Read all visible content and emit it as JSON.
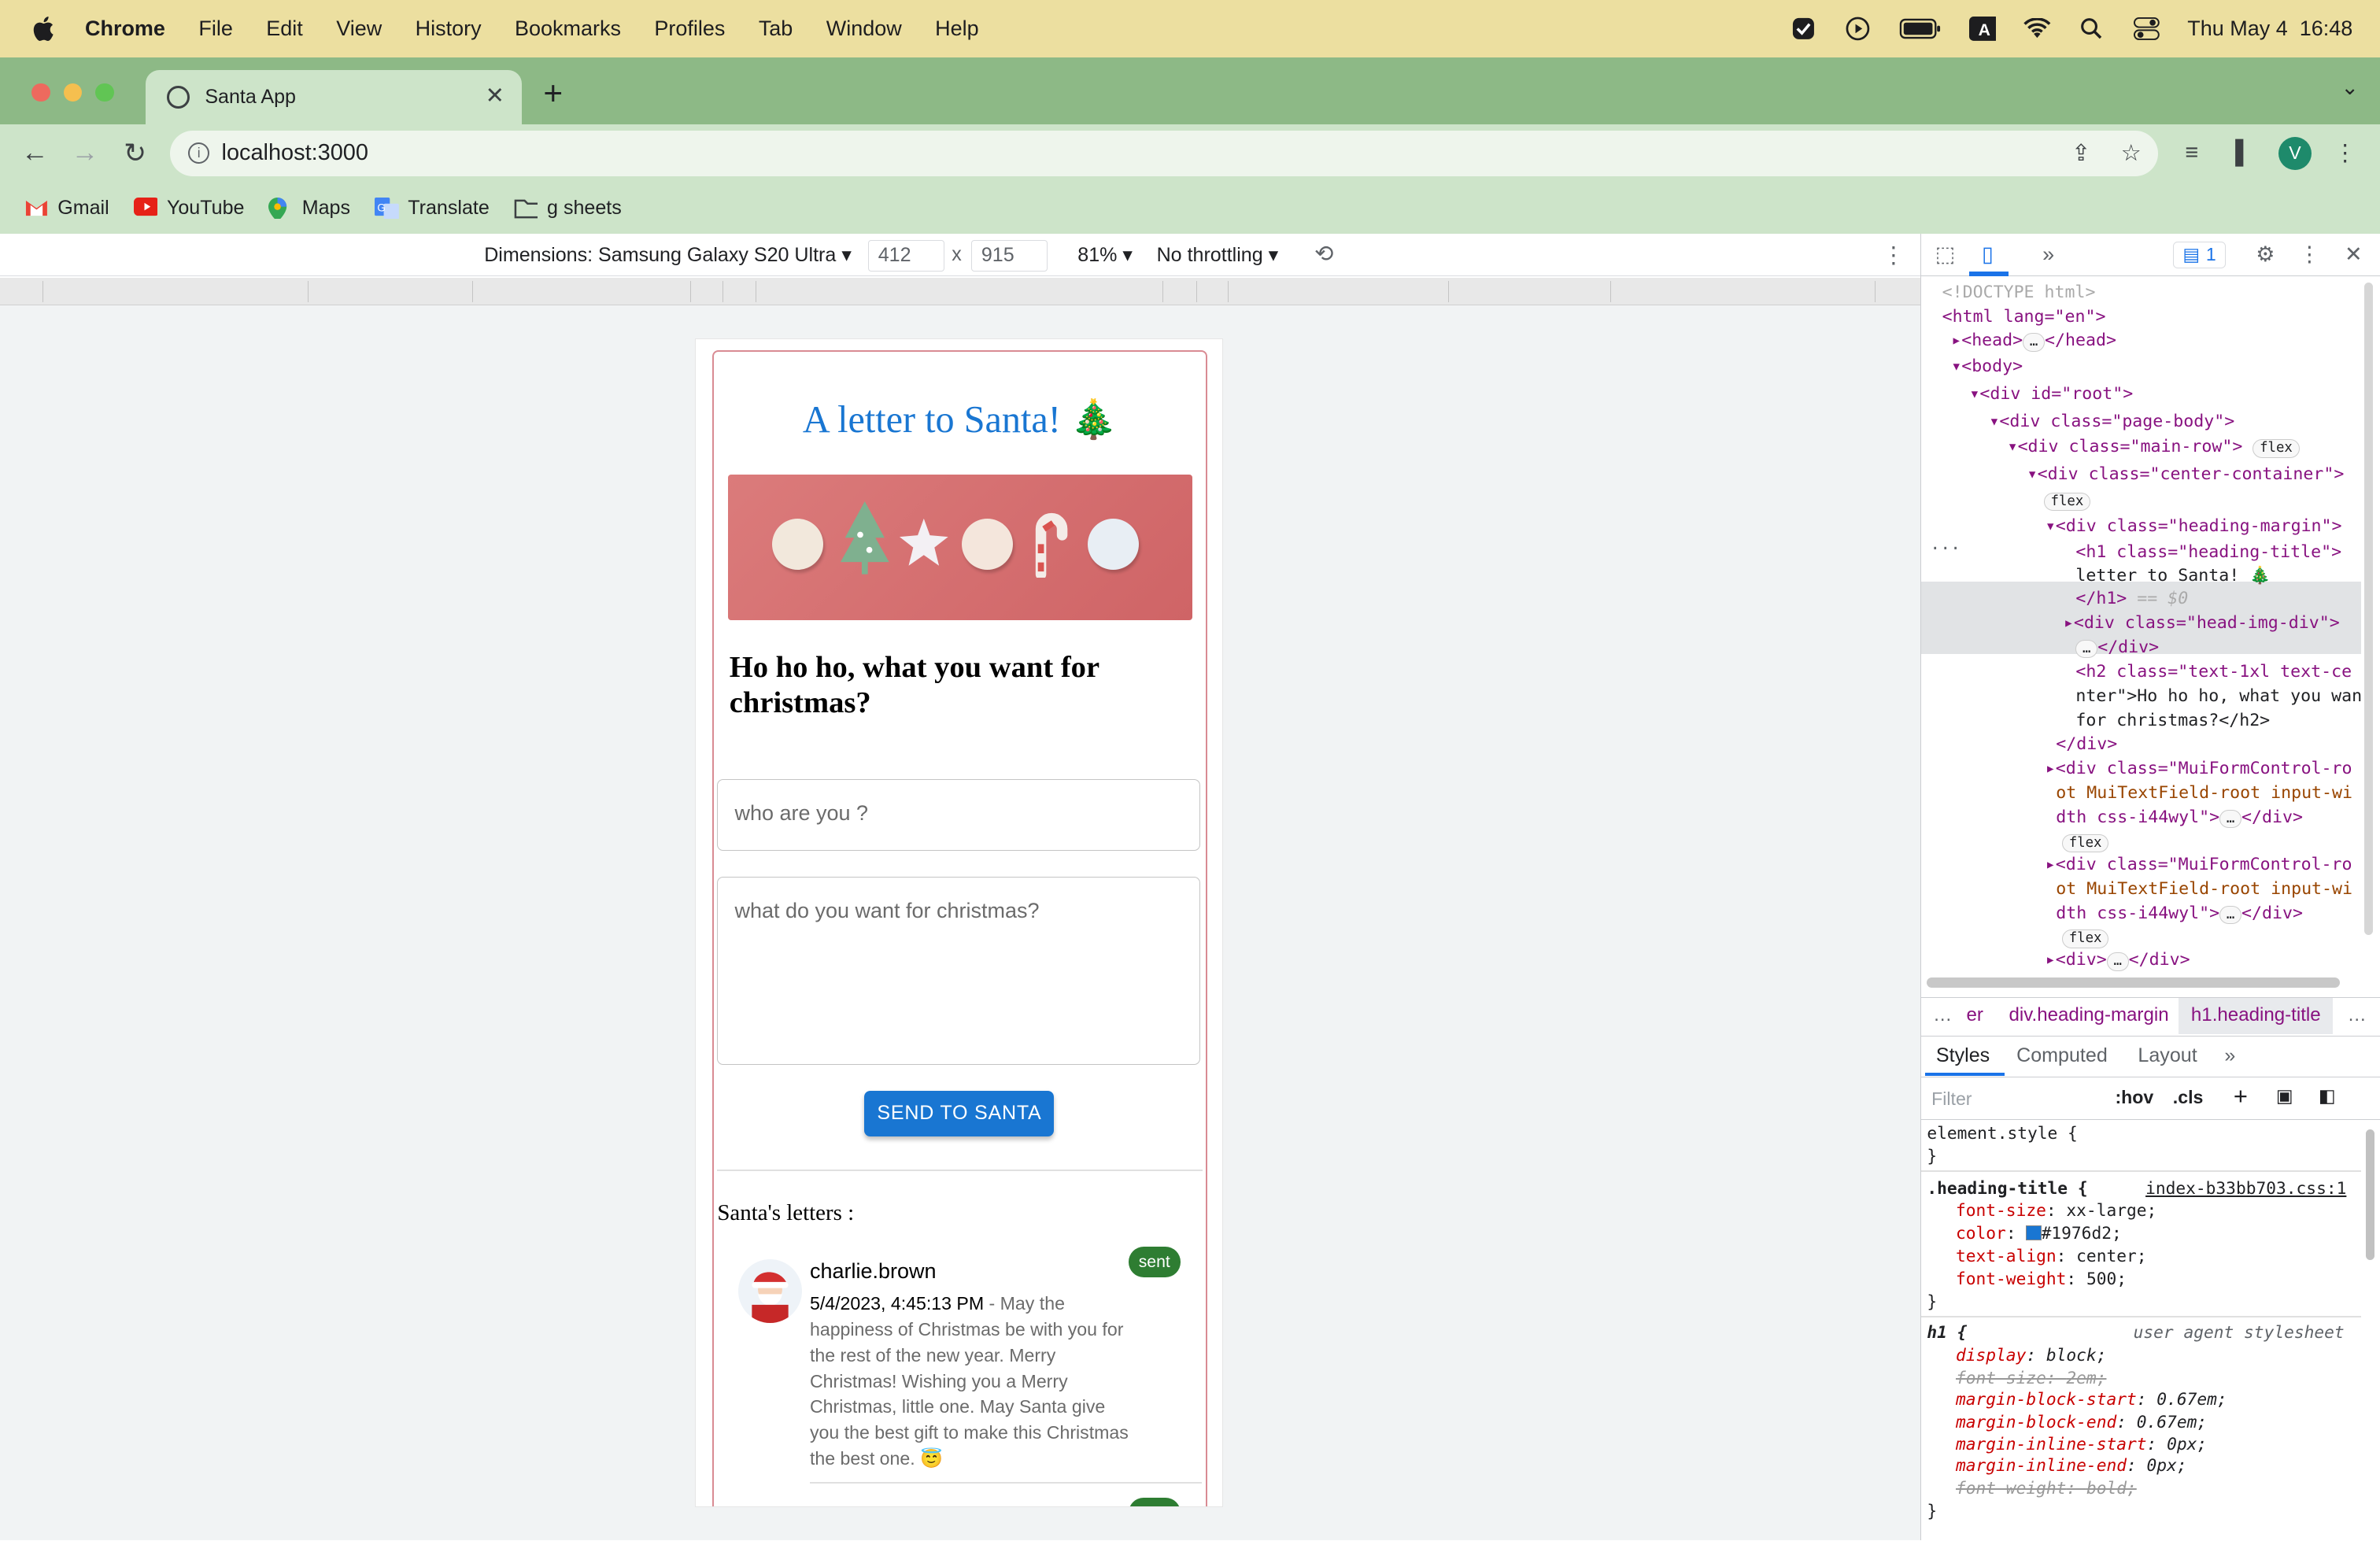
{
  "menubar": {
    "app_name": "Chrome",
    "items": [
      "File",
      "Edit",
      "View",
      "History",
      "Bookmarks",
      "Profiles",
      "Tab",
      "Window",
      "Help"
    ],
    "clock": "Thu May 4  16:48"
  },
  "browser": {
    "tab_title": "Santa App",
    "url": "localhost:3000",
    "profile_initial": "V",
    "bookmarks": [
      "Gmail",
      "YouTube",
      "Maps",
      "Translate",
      "g sheets"
    ]
  },
  "device_toolbar": {
    "dimensions_label": "Dimensions: Samsung Galaxy S20 Ultra",
    "width": "412",
    "times": "x",
    "height": "915",
    "zoom": "81%",
    "throttling": "No throttling"
  },
  "page": {
    "title": "A letter to Santa! 🎄",
    "subtitle": "Ho ho ho, what you want for christmas?",
    "name_placeholder": "who are you ?",
    "wish_placeholder": "what do you want for christmas?",
    "send_label": "SEND TO SANTA",
    "letters_heading": "Santa's letters :",
    "letters": [
      {
        "user": "charlie.brown",
        "timestamp": "5/4/2023, 4:45:13 PM",
        "separator": " - ",
        "message": "May the happiness of Christmas be with you for the rest of the new year. Merry Christmas! Wishing you a Merry Christmas, little one. May Santa give you the best gift to make this Christmas the best one. 😇",
        "status": "sent"
      }
    ]
  },
  "devtools": {
    "issues_count": "1",
    "dom": {
      "doctype": "<!DOCTYPE html>",
      "html_open": "<html lang=\"en\">",
      "head": "<head>",
      "head_close": "</head>",
      "body": "<body>",
      "root": "<div id=\"root\">",
      "page_body": "<div class=\"page-body\">",
      "main_row": "<div class=\"main-row\">",
      "center_container": "<div class=\"center-container\">",
      "heading_margin": "<div class=\"heading-margin\">",
      "h1_open": "<h1 class=\"heading-title\">",
      "h1_text": "letter to Santa! 🎄",
      "h1_close": "</h1>",
      "h1_suffix": " == $0",
      "head_img": "<div class=\"head-img-div\">",
      "div_close": "</div>",
      "h2_line1": "<h2 class=\"text-1xl text-ce",
      "h2_line2": "nter\">Ho ho ho, what you wan",
      "h2_line3": "for christmas?</h2>",
      "mui_line1": "<div class=\"MuiFormControl-ro",
      "mui_line2": "ot MuiTextField-root input-wi",
      "mui_line3": "dth css-i44wyl\">",
      "last_div": "<div>",
      "flex_badge": "flex",
      "ellipsis": "…"
    },
    "breadcrumbs": [
      "…",
      "er",
      "div.heading-margin",
      "h1.heading-title",
      "…"
    ],
    "styles_tabs": [
      "Styles",
      "Computed",
      "Layout"
    ],
    "filter_placeholder": "Filter",
    "hov": ":hov",
    "cls": ".cls",
    "css_rules": {
      "element_style": "element.style {",
      "close": "}",
      "heading_selector": ".heading-title {",
      "heading_source": "index-b33bb703.css:1",
      "heading_props": [
        {
          "name": "font-size",
          "value": "xx-large;"
        },
        {
          "name": "color",
          "value": "#1976d2;"
        },
        {
          "name": "text-align",
          "value": "center;"
        },
        {
          "name": "font-weight",
          "value": "500;"
        }
      ],
      "h1_selector": "h1 {",
      "h1_source": "user agent stylesheet",
      "h1_props": [
        {
          "name": "display",
          "value": "block;",
          "struck": false
        },
        {
          "name": "font-size",
          "value": "2em;",
          "struck": true
        },
        {
          "name": "margin-block-start",
          "value": "0.67em;",
          "struck": false
        },
        {
          "name": "margin-block-end",
          "value": "0.67em;",
          "struck": false
        },
        {
          "name": "margin-inline-start",
          "value": "0px;",
          "struck": false
        },
        {
          "name": "margin-inline-end",
          "value": "0px;",
          "struck": false
        },
        {
          "name": "font-weight",
          "value": "bold;",
          "struck": true
        }
      ]
    }
  },
  "colors": {
    "menubar_bg": "#ecdfa0",
    "tabstrip_bg": "#8db986",
    "toolbar_bg": "#cde4c9",
    "accent_blue": "#1976d2",
    "sent_green": "#2e7d32",
    "card_border": "#d98b93"
  }
}
